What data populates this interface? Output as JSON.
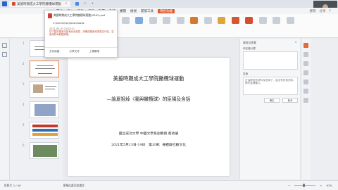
{
  "window": {
    "tab1_title": "美援時期成大工學院撇欖球運動",
    "tab2_title": "",
    "window_controls": [
      "—",
      "□",
      "✕"
    ]
  },
  "menubar": {
    "items": [
      "開始",
      "插入",
      "設計",
      "切換",
      "動畫",
      "放映",
      "審閱",
      "檢視",
      "開發工具",
      "特色功能"
    ],
    "right_items": [
      "搜尋",
      "分享",
      "？"
    ]
  },
  "ribbon": {
    "tools": [
      {
        "label": "",
        "icon": "paste-icon",
        "color": "#e46e3a"
      },
      {
        "label": "",
        "icon": "new-slide-icon",
        "color": "#e38b49"
      },
      {
        "label": "",
        "icon": "layout-icon",
        "color": "#c9cfd8"
      },
      {
        "label": "",
        "icon": "shape-icon",
        "color": "#7fa9e0"
      },
      {
        "label": "",
        "icon": "textbox-icon",
        "color": "#c9cfd8"
      },
      {
        "label": "",
        "icon": "font-icon",
        "color": "#c9cfd8"
      },
      {
        "label": "",
        "icon": "align-icon",
        "color": "#c9cfd8"
      },
      {
        "label": "",
        "icon": "picture-icon",
        "color": "#d6792f"
      },
      {
        "label": "",
        "icon": "table-icon",
        "color": "#c9cfd8"
      },
      {
        "label": "",
        "icon": "chart-icon",
        "color": "#e0a53a"
      },
      {
        "label": "",
        "icon": "smartart-icon",
        "color": "#d2582f"
      },
      {
        "label": "",
        "icon": "play-icon",
        "color": "#d94a33"
      },
      {
        "label": "",
        "icon": "find-icon",
        "color": "#c9cfd8"
      },
      {
        "label": "",
        "icon": "select-icon",
        "color": "#c9cfd8"
      },
      {
        "label": "",
        "icon": "settings-icon",
        "color": "#c9cfd8"
      }
    ]
  },
  "popup": {
    "filename": "美援時期成大工學院撇欖球運動(0361).pdf",
    "path": "C:\\Users\\hsej\\Downloads",
    "time": "2021-05-20 22:03:11",
    "warning": "您下載的檔案可能有安全風險，請確認檔案來源是否可信，並使用防毒軟體掃描。",
    "actions": [
      "文件保護",
      "分享文件",
      "上傳雲端"
    ]
  },
  "slide": {
    "title_line1": "美援時期成大工學院撇欖球運動",
    "title_line2": "—論夏祖焯〈我與撇欖球〉的臣陽及含括",
    "author": "國立成功大學 中國文學系副教授 蔡玫姿",
    "event": "2021年5月13日-14日　第三場：身體與社群文化"
  },
  "thumbs": {
    "numbers": [
      "1",
      "2",
      "3",
      "4",
      "5",
      "6"
    ],
    "selected_index": 1
  },
  "right_panel": {
    "title": "資料及答案",
    "box1_label": "你在做什麼",
    "box2_label": "答案",
    "box2_text": "在這裡回答資料及答案了。還沒有查到資料，請在這裡輸入。",
    "button1": "確定",
    "button2": "取消"
  },
  "status": {
    "slide_info": "投影片 2 / 46",
    "notes_label": "單擊此處添加備註",
    "zoom": "63%"
  }
}
